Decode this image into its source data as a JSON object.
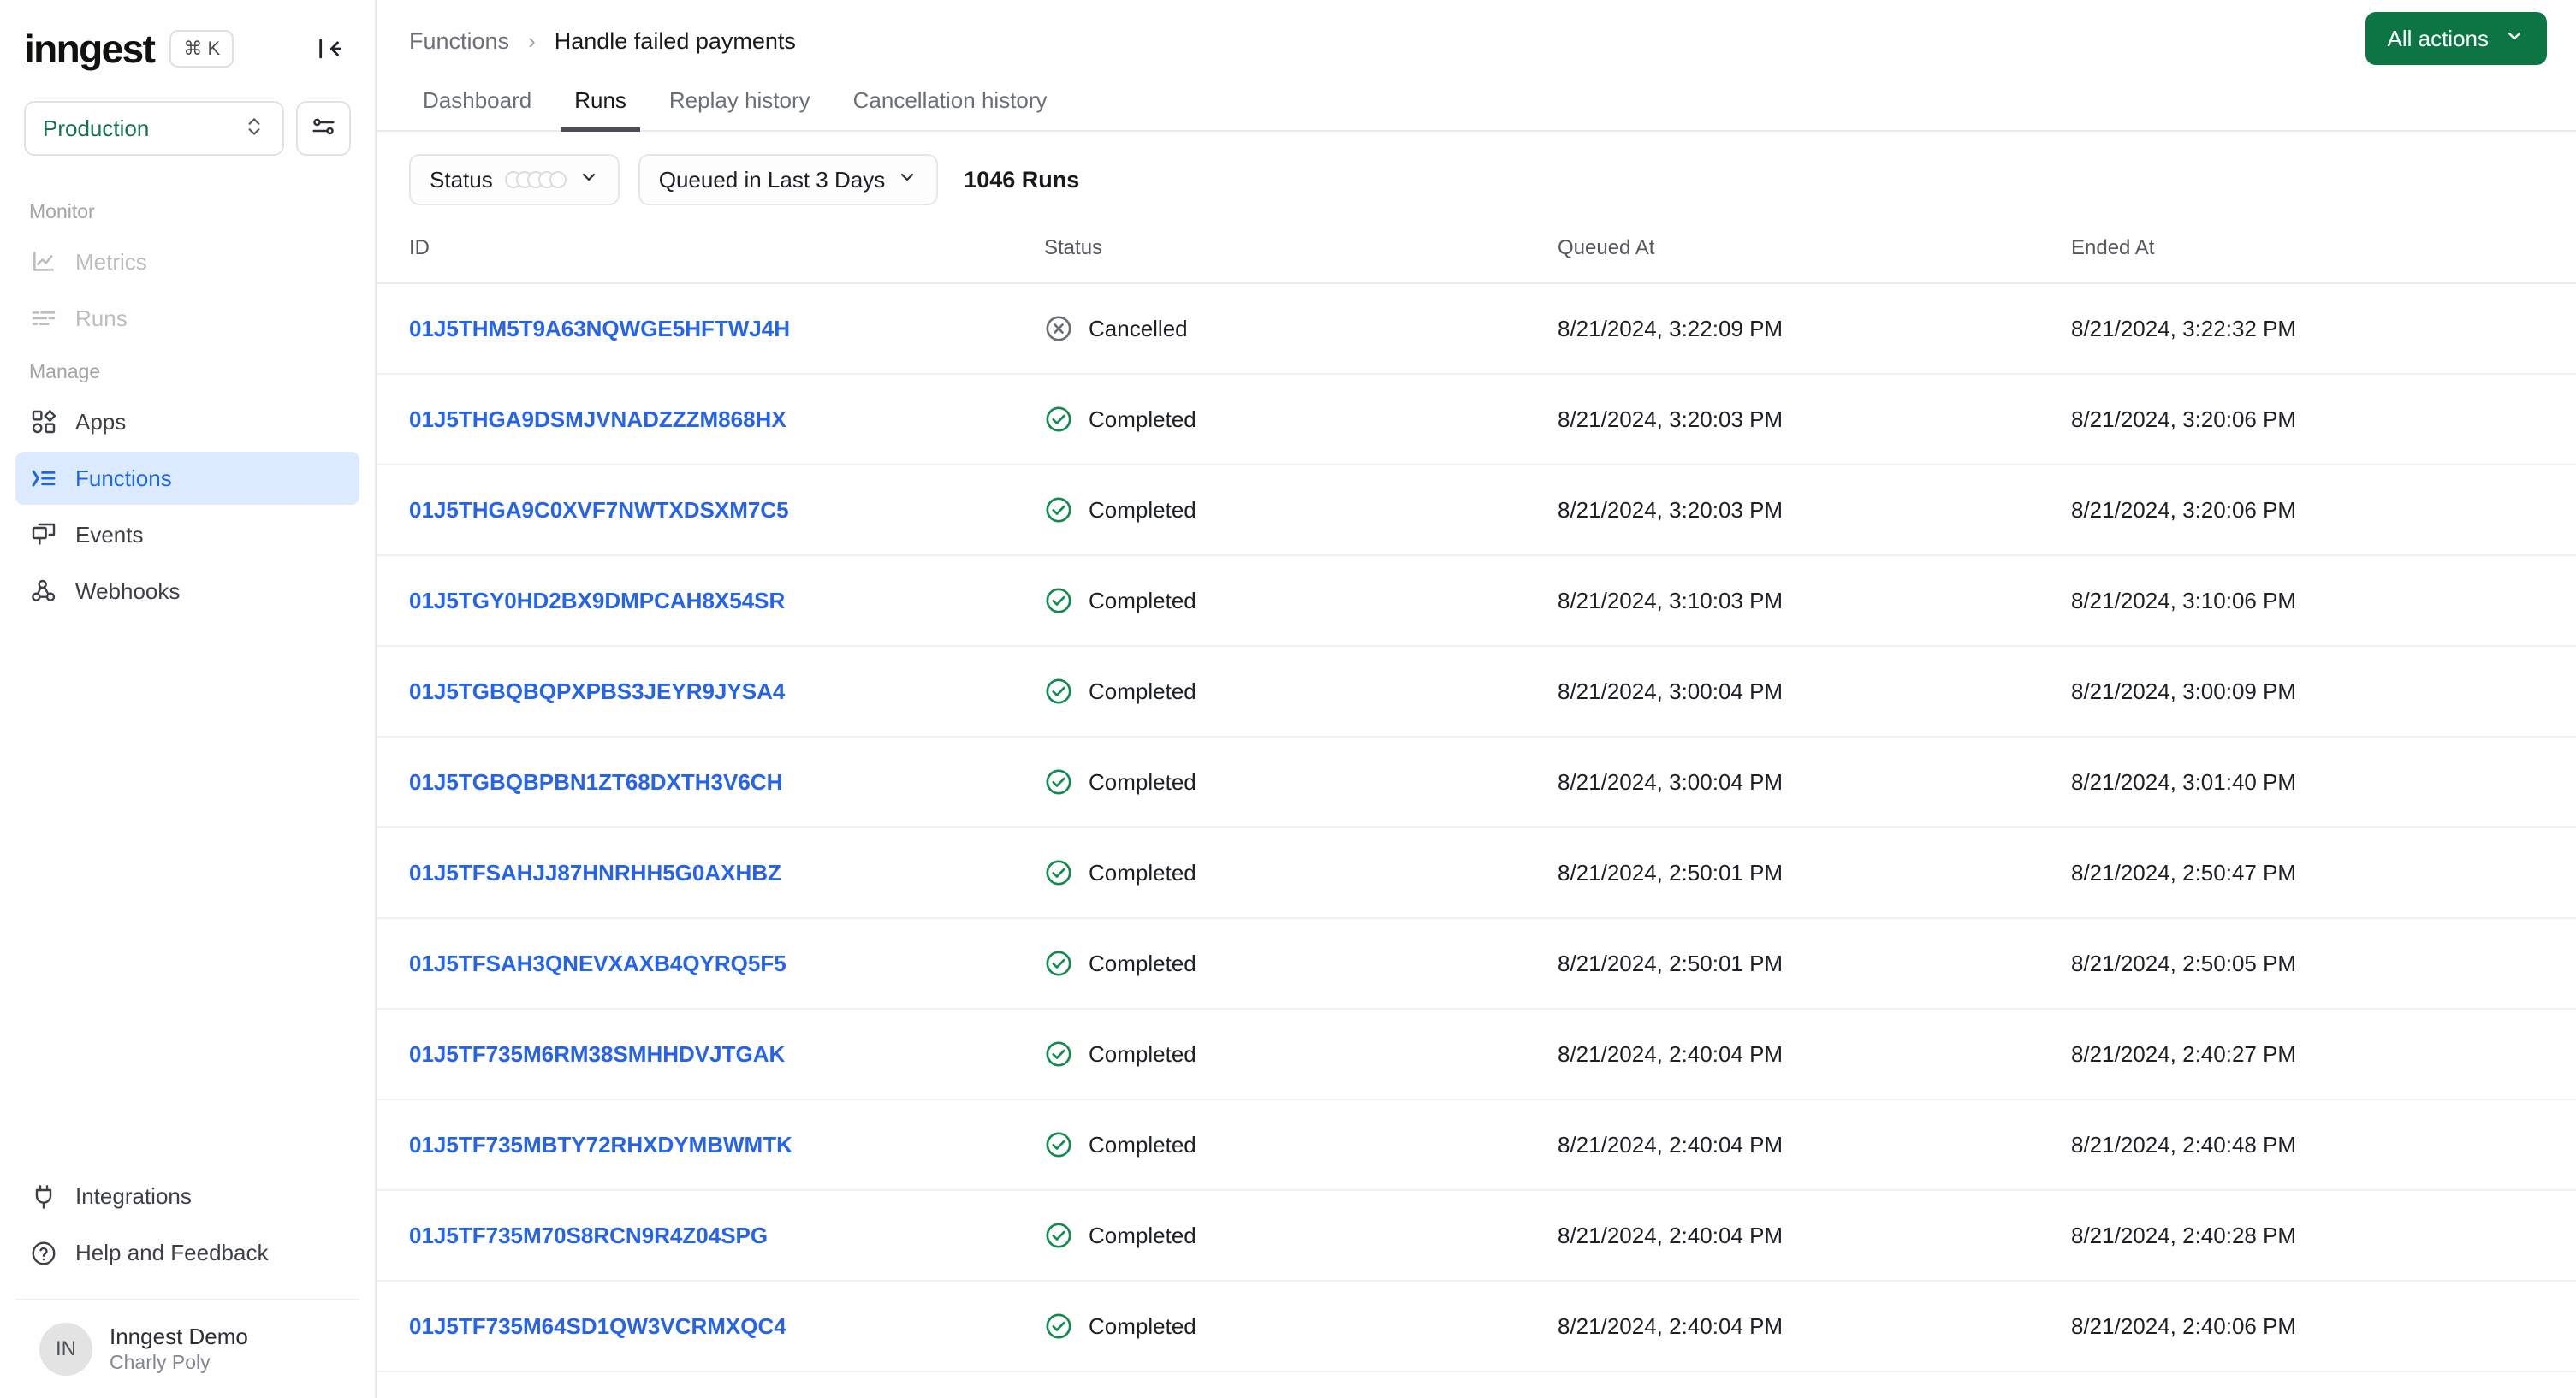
{
  "sidebar": {
    "logo_text": "inngest",
    "shortcut": "⌘ K",
    "collapse_icon": "collapse-sidebar-icon",
    "environment": {
      "label": "Production",
      "chevron": "chevron-updown-icon"
    },
    "env_settings_icon": "sliders-icon",
    "groups": [
      {
        "label": "Monitor",
        "items": [
          {
            "label": "Metrics",
            "icon": "chart-line-icon",
            "state": "disabled"
          },
          {
            "label": "Runs",
            "icon": "runs-list-icon",
            "state": "disabled"
          }
        ]
      },
      {
        "label": "Manage",
        "items": [
          {
            "label": "Apps",
            "icon": "apps-grid-icon",
            "state": "default"
          },
          {
            "label": "Functions",
            "icon": "functions-icon",
            "state": "active"
          },
          {
            "label": "Events",
            "icon": "events-icon",
            "state": "default"
          },
          {
            "label": "Webhooks",
            "icon": "webhooks-icon",
            "state": "default"
          }
        ]
      }
    ],
    "footer_items": [
      {
        "label": "Integrations",
        "icon": "plug-icon"
      },
      {
        "label": "Help and Feedback",
        "icon": "question-circle-icon"
      }
    ],
    "user": {
      "initials": "IN",
      "name": "Inngest Demo",
      "account": "Charly Poly"
    }
  },
  "header": {
    "breadcrumb": {
      "root": "Functions",
      "separator": "›",
      "current": "Handle failed payments"
    },
    "all_actions": {
      "label": "All actions",
      "chevron": "chevron-down-icon"
    },
    "tabs": [
      {
        "label": "Dashboard",
        "active": false
      },
      {
        "label": "Runs",
        "active": true
      },
      {
        "label": "Replay history",
        "active": false
      },
      {
        "label": "Cancellation history",
        "active": false
      }
    ]
  },
  "filters": {
    "status": {
      "label": "Status",
      "dots": 5,
      "chevron": "chevron-down-icon"
    },
    "time": {
      "label": "Queued in Last 3 Days",
      "chevron": "chevron-down-icon"
    },
    "runs_count": "1046 Runs"
  },
  "table": {
    "columns": [
      "ID",
      "Status",
      "Queued At",
      "Ended At"
    ],
    "rows": [
      {
        "id": "01J5THM5T9A63NQWGE5HFTWJ4H",
        "status": "Cancelled",
        "status_icon": "x-circle-icon",
        "queued_at": "8/21/2024, 3:22:09 PM",
        "ended_at": "8/21/2024, 3:22:32 PM"
      },
      {
        "id": "01J5THGA9DSMJVNADZZZM868HX",
        "status": "Completed",
        "status_icon": "check-circle-icon",
        "queued_at": "8/21/2024, 3:20:03 PM",
        "ended_at": "8/21/2024, 3:20:06 PM"
      },
      {
        "id": "01J5THGA9C0XVF7NWTXDSXM7C5",
        "status": "Completed",
        "status_icon": "check-circle-icon",
        "queued_at": "8/21/2024, 3:20:03 PM",
        "ended_at": "8/21/2024, 3:20:06 PM"
      },
      {
        "id": "01J5TGY0HD2BX9DMPCAH8X54SR",
        "status": "Completed",
        "status_icon": "check-circle-icon",
        "queued_at": "8/21/2024, 3:10:03 PM",
        "ended_at": "8/21/2024, 3:10:06 PM"
      },
      {
        "id": "01J5TGBQBQPXPBS3JEYR9JYSA4",
        "status": "Completed",
        "status_icon": "check-circle-icon",
        "queued_at": "8/21/2024, 3:00:04 PM",
        "ended_at": "8/21/2024, 3:00:09 PM"
      },
      {
        "id": "01J5TGBQBPBN1ZT68DXTH3V6CH",
        "status": "Completed",
        "status_icon": "check-circle-icon",
        "queued_at": "8/21/2024, 3:00:04 PM",
        "ended_at": "8/21/2024, 3:01:40 PM"
      },
      {
        "id": "01J5TFSAHJJ87HNRHH5G0AXHBZ",
        "status": "Completed",
        "status_icon": "check-circle-icon",
        "queued_at": "8/21/2024, 2:50:01 PM",
        "ended_at": "8/21/2024, 2:50:47 PM"
      },
      {
        "id": "01J5TFSAH3QNEVXAXB4QYRQ5F5",
        "status": "Completed",
        "status_icon": "check-circle-icon",
        "queued_at": "8/21/2024, 2:50:01 PM",
        "ended_at": "8/21/2024, 2:50:05 PM"
      },
      {
        "id": "01J5TF735M6RM38SMHHDVJTGAK",
        "status": "Completed",
        "status_icon": "check-circle-icon",
        "queued_at": "8/21/2024, 2:40:04 PM",
        "ended_at": "8/21/2024, 2:40:27 PM"
      },
      {
        "id": "01J5TF735MBTY72RHXDYMBWMTK",
        "status": "Completed",
        "status_icon": "check-circle-icon",
        "queued_at": "8/21/2024, 2:40:04 PM",
        "ended_at": "8/21/2024, 2:40:48 PM"
      },
      {
        "id": "01J5TF735M70S8RCN9R4Z04SPG",
        "status": "Completed",
        "status_icon": "check-circle-icon",
        "queued_at": "8/21/2024, 2:40:04 PM",
        "ended_at": "8/21/2024, 2:40:28 PM"
      },
      {
        "id": "01J5TF735M64SD1QW3VCRMXQC4",
        "status": "Completed",
        "status_icon": "check-circle-icon",
        "queued_at": "8/21/2024, 2:40:04 PM",
        "ended_at": "8/21/2024, 2:40:06 PM"
      }
    ]
  },
  "colors": {
    "accent_green": "#0d7544",
    "link_blue": "#2563eb",
    "active_nav_bg": "#dbeafe",
    "active_nav_fg": "#1f66e5",
    "status_completed": "#128a4e",
    "status_cancelled": "#6b7076"
  }
}
